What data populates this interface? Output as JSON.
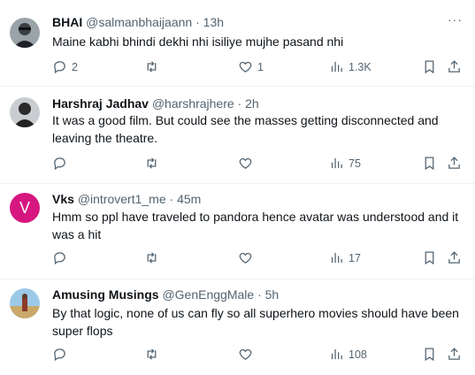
{
  "tweets": [
    {
      "name": "BHAI",
      "handle": "@salmanbhaijaann",
      "time": "13h",
      "text": "Maine kabhi bhindi dekhi nhi isiliye mujhe pasand nhi",
      "replies": "2",
      "retweets": "",
      "likes": "1",
      "views": "1.3K"
    },
    {
      "name": "Harshraj Jadhav",
      "handle": "@harshrajhere",
      "time": "2h",
      "text": "It was a good film.  But could see the masses getting disconnected and leaving the theatre.",
      "replies": "",
      "retweets": "",
      "likes": "",
      "views": "75"
    },
    {
      "name": "Vks",
      "handle": "@introvert1_me",
      "time": "45m",
      "avatar_letter": "V",
      "text": "Hmm so ppl have traveled to pandora hence avatar was understood and it was a hit",
      "replies": "",
      "retweets": "",
      "likes": "",
      "views": "17"
    },
    {
      "name": "Amusing Musings",
      "handle": "@GenEnggMale",
      "time": "5h",
      "text": "By that logic, none of us can fly so all superhero movies should have been super flops",
      "replies": "",
      "retweets": "",
      "likes": "",
      "views": "108"
    }
  ],
  "separator": "·",
  "more_label": "···",
  "colors": {
    "avatar_v": "#d6177f",
    "muted": "#536471",
    "text": "#0f1419"
  }
}
